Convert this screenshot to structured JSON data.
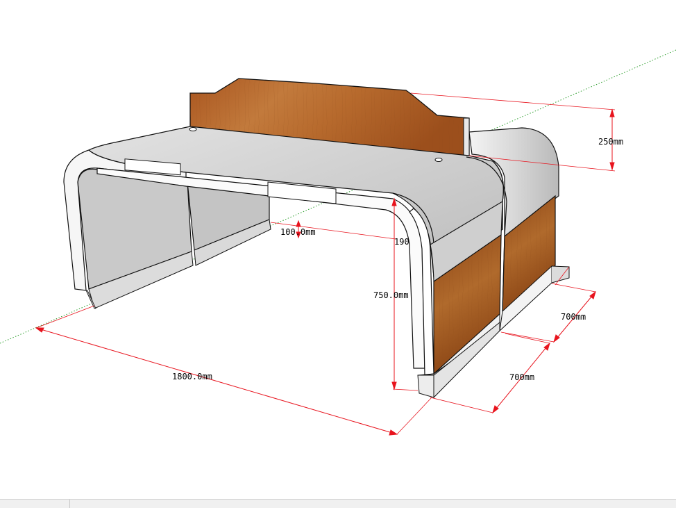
{
  "dimensions": {
    "width_label": "1800.0mm",
    "height_label": "750.0mm",
    "depth_front_label": "700mm",
    "depth_back_label": "700mm",
    "panel_height_label": "250mm",
    "inner_offset_label": "100.0mm",
    "partial_label": "190"
  },
  "colors": {
    "dimension_line": "#e8141e",
    "wood": "#b0652a",
    "axis_green": "#2a9d2a"
  }
}
